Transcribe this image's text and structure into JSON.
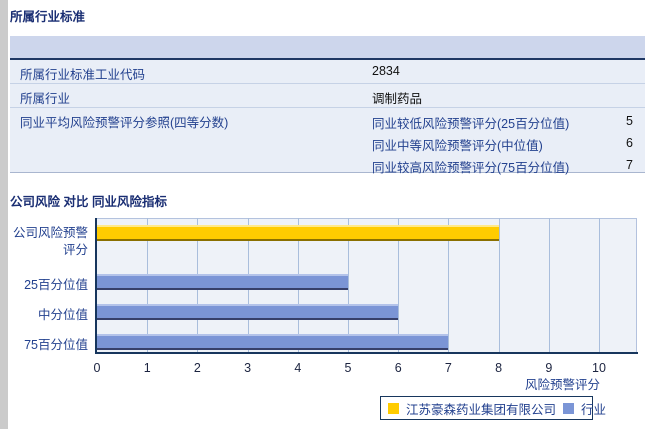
{
  "sections": {
    "industry_title": "所属行业标准",
    "comparison_title": "公司风险 对比 同业风险指标"
  },
  "industry_table": {
    "rows": [
      {
        "label": "所属行业标准工业代码",
        "value": "2834"
      },
      {
        "label": "所属行业",
        "value": "调制药品"
      },
      {
        "label": "同业平均风险预警评分参照(四等分数)",
        "value": ""
      }
    ],
    "peer_score_rows": [
      {
        "label": "同业较低风险预警评分(25百分位值)",
        "value": "5"
      },
      {
        "label": "同业中等风险预警评分(中位值)",
        "value": "6"
      },
      {
        "label": "同业较高风险预警评分(75百分位值)",
        "value": "7"
      }
    ]
  },
  "chart_data": {
    "type": "bar",
    "orientation": "horizontal",
    "title": "公司风险 对比 同业风险指标",
    "categories": [
      "公司风险预警评分",
      "25百分位值",
      "中分位值",
      "75百分位值"
    ],
    "series": [
      {
        "name": "江苏豪森药业集团有限公司",
        "color": "#ffcc00",
        "values": [
          8,
          null,
          null,
          null
        ]
      },
      {
        "name": "行业",
        "color": "#7b95d6",
        "values": [
          null,
          5,
          6,
          7
        ]
      }
    ],
    "xlabel": "风险预警评分",
    "xlim": [
      0,
      10
    ],
    "xticks": [
      0,
      1,
      2,
      3,
      4,
      5,
      6,
      7,
      8,
      9,
      10
    ],
    "grid": true,
    "legend_position": "bottom"
  },
  "colors": {
    "accent_navy": "#17365d",
    "label_blue": "#23418f",
    "header_band": "#cdd6ec",
    "row_bg": "#e9eef7",
    "company_bar": "#ffcc00",
    "industry_bar": "#7b95d6"
  }
}
